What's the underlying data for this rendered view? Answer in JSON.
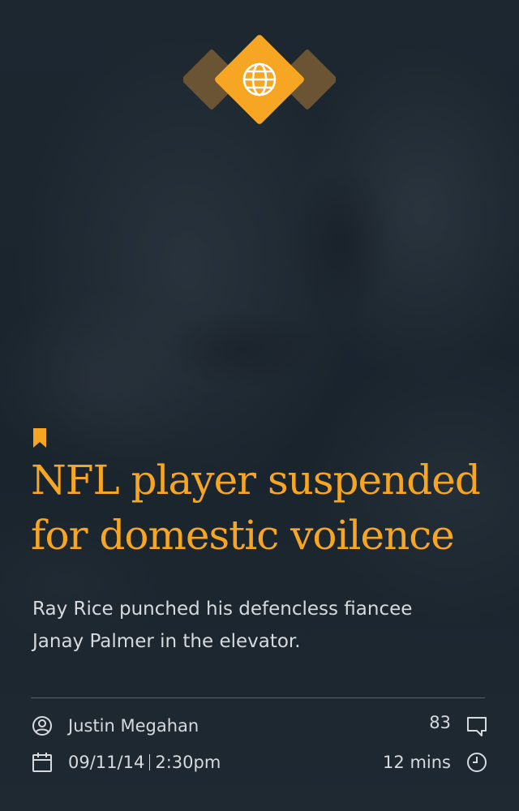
{
  "article": {
    "category_icon": "globe-icon",
    "bookmark_icon": "bookmark-icon",
    "headline_line1": "NFL player suspended",
    "headline_line2": "for domestic voilence",
    "summary_line1": "Ray Rice punched his defencless fiancee",
    "summary_line2": "Janay Palmer in the elevator."
  },
  "meta": {
    "author": "Justin Megahan",
    "author_icon": "user-icon",
    "date": "09/11/14",
    "time": "2:30pm",
    "date_icon": "calendar-icon",
    "comment_count": "83",
    "comment_icon": "comment-icon",
    "read_time": "12 mins",
    "read_time_icon": "clock-icon"
  },
  "colors": {
    "accent": "#f6a623",
    "accent_dark": "#6b5433",
    "background": "#1c262f",
    "text": "#d6dade",
    "divider": "#55606a"
  }
}
